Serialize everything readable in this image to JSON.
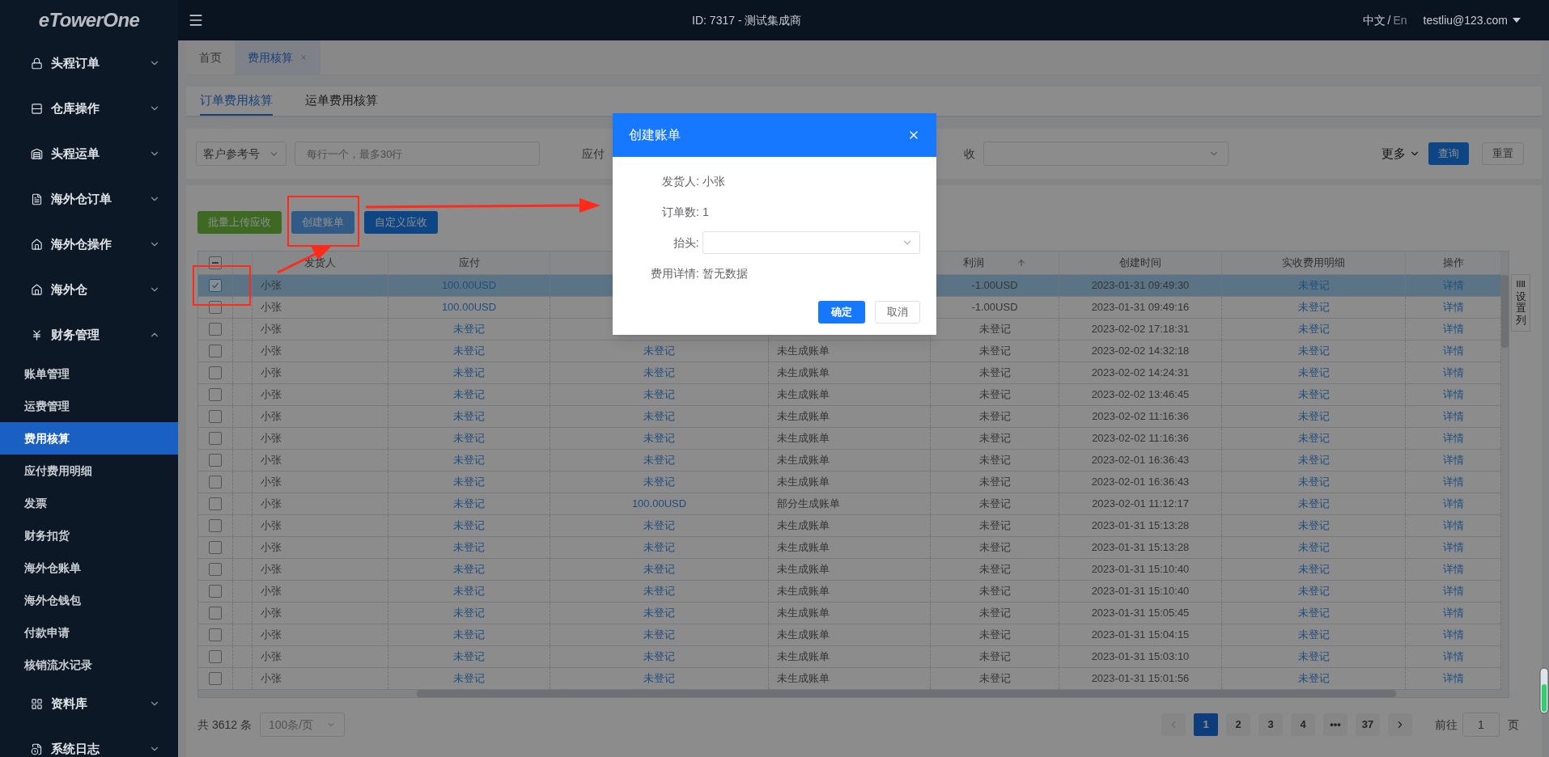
{
  "header": {
    "logo": "eTowerOne",
    "title": "ID: 7317 - 测试集成商",
    "language_current": "中文",
    "language_separator": "/",
    "language_other": "En",
    "user": "testliu@123.com"
  },
  "sidebar": {
    "items": [
      {
        "label": "头程订单",
        "expanded": false
      },
      {
        "label": "仓库操作",
        "expanded": false
      },
      {
        "label": "头程运单",
        "expanded": false
      },
      {
        "label": "海外仓订单",
        "expanded": false
      },
      {
        "label": "海外仓操作",
        "expanded": false
      },
      {
        "label": "海外仓",
        "expanded": false
      },
      {
        "label": "财务管理",
        "expanded": true,
        "children": [
          {
            "label": "账单管理",
            "selected": false
          },
          {
            "label": "运费管理",
            "selected": false
          },
          {
            "label": "费用核算",
            "selected": true
          },
          {
            "label": "应付费用明细",
            "selected": false
          },
          {
            "label": "发票",
            "selected": false
          },
          {
            "label": "财务扣货",
            "selected": false
          },
          {
            "label": "海外仓账单",
            "selected": false
          },
          {
            "label": "海外仓钱包",
            "selected": false
          },
          {
            "label": "付款申请",
            "selected": false
          },
          {
            "label": "核销流水记录",
            "selected": false
          }
        ]
      },
      {
        "label": "资料库",
        "expanded": false
      },
      {
        "label": "系统日志",
        "expanded": false
      }
    ]
  },
  "page_tabs": [
    {
      "label": "首页",
      "selected": false,
      "closable": false
    },
    {
      "label": "费用核算",
      "selected": true,
      "closable": true
    }
  ],
  "sub_tabs": [
    {
      "label": "订单费用核算",
      "selected": true
    },
    {
      "label": "运单费用核算",
      "selected": false
    }
  ],
  "filters": {
    "field_select": "客户参考号",
    "input_placeholder": "每行一个，最多30行",
    "label_1": "应付",
    "label_2": "收",
    "more": "更多",
    "search_button": "查询",
    "reset_button": "重置"
  },
  "actions": [
    {
      "label": "批量上传应收",
      "kind": "success"
    },
    {
      "label": "创建账单",
      "kind": "light"
    },
    {
      "label": "自定义应收",
      "kind": "primary"
    }
  ],
  "table": {
    "header_checkbox_indeterminate": true,
    "columns": {
      "shipper": "发货人",
      "payable": "应付",
      "profit": "利润",
      "created": "创建时间",
      "received_detail": "实收费用明细",
      "action": "操作"
    },
    "rows": [
      {
        "selected": true,
        "shipper": "小张",
        "payable": "100.00USD",
        "profit": "-1.00USD",
        "created": "2023-01-31 09:49:30",
        "received_detail": "未登记",
        "action": "详情"
      },
      {
        "selected": false,
        "shipper": "小张",
        "payable": "100.00USD",
        "profit": "-1.00USD",
        "created": "2023-01-31 09:49:16",
        "received_detail": "未登记",
        "action": "详情"
      },
      {
        "selected": false,
        "shipper": "小张",
        "payable": "未登记",
        "profit": "未登记",
        "created": "2023-02-02 17:18:31",
        "received_detail": "未登记",
        "action": "详情"
      },
      {
        "selected": false,
        "shipper": "小张",
        "payable": "未登记",
        "column_3": "未登记",
        "column_4": "未生成账单",
        "profit": "未登记",
        "created": "2023-02-02 14:32:18",
        "received_detail": "未登记",
        "action": "详情"
      },
      {
        "selected": false,
        "shipper": "小张",
        "payable": "未登记",
        "column_3": "未登记",
        "column_4": "未生成账单",
        "profit": "未登记",
        "created": "2023-02-02 14:24:31",
        "received_detail": "未登记",
        "action": "详情"
      },
      {
        "selected": false,
        "shipper": "小张",
        "payable": "未登记",
        "column_3": "未登记",
        "column_4": "未生成账单",
        "profit": "未登记",
        "created": "2023-02-02 13:46:45",
        "received_detail": "未登记",
        "action": "详情"
      },
      {
        "selected": false,
        "shipper": "小张",
        "payable": "未登记",
        "column_3": "未登记",
        "column_4": "未生成账单",
        "profit": "未登记",
        "created": "2023-02-02 11:16:36",
        "received_detail": "未登记",
        "action": "详情"
      },
      {
        "selected": false,
        "shipper": "小张",
        "payable": "未登记",
        "column_3": "未登记",
        "column_4": "未生成账单",
        "profit": "未登记",
        "created": "2023-02-02 11:16:36",
        "received_detail": "未登记",
        "action": "详情"
      },
      {
        "selected": false,
        "shipper": "小张",
        "payable": "未登记",
        "column_3": "未登记",
        "column_4": "未生成账单",
        "profit": "未登记",
        "created": "2023-02-01 16:36:43",
        "received_detail": "未登记",
        "action": "详情"
      },
      {
        "selected": false,
        "shipper": "小张",
        "payable": "未登记",
        "column_3": "未登记",
        "column_4": "未生成账单",
        "profit": "未登记",
        "created": "2023-02-01 16:36:43",
        "received_detail": "未登记",
        "action": "详情"
      },
      {
        "selected": false,
        "shipper": "小张",
        "payable": "未登记",
        "column_3": "100.00USD",
        "column_4": "部分生成账单",
        "profit": "未登记",
        "created": "2023-02-01 11:12:17",
        "received_detail": "未登记",
        "action": "详情"
      },
      {
        "selected": false,
        "shipper": "小张",
        "payable": "未登记",
        "column_3": "未登记",
        "column_4": "未生成账单",
        "profit": "未登记",
        "created": "2023-01-31 15:13:28",
        "received_detail": "未登记",
        "action": "详情"
      },
      {
        "selected": false,
        "shipper": "小张",
        "payable": "未登记",
        "column_3": "未登记",
        "column_4": "未生成账单",
        "profit": "未登记",
        "created": "2023-01-31 15:13:28",
        "received_detail": "未登记",
        "action": "详情"
      },
      {
        "selected": false,
        "shipper": "小张",
        "payable": "未登记",
        "column_3": "未登记",
        "column_4": "未生成账单",
        "profit": "未登记",
        "created": "2023-01-31 15:10:40",
        "received_detail": "未登记",
        "action": "详情"
      },
      {
        "selected": false,
        "shipper": "小张",
        "payable": "未登记",
        "column_3": "未登记",
        "column_4": "未生成账单",
        "profit": "未登记",
        "created": "2023-01-31 15:10:40",
        "received_detail": "未登记",
        "action": "详情"
      },
      {
        "selected": false,
        "shipper": "小张",
        "payable": "未登记",
        "column_3": "未登记",
        "column_4": "未生成账单",
        "profit": "未登记",
        "created": "2023-01-31 15:05:45",
        "received_detail": "未登记",
        "action": "详情"
      },
      {
        "selected": false,
        "shipper": "小张",
        "payable": "未登记",
        "column_3": "未登记",
        "column_4": "未生成账单",
        "profit": "未登记",
        "created": "2023-01-31 15:04:15",
        "received_detail": "未登记",
        "action": "详情"
      },
      {
        "selected": false,
        "shipper": "小张",
        "payable": "未登记",
        "column_3": "未登记",
        "column_4": "未生成账单",
        "profit": "未登记",
        "created": "2023-01-31 15:03:10",
        "received_detail": "未登记",
        "action": "详情"
      },
      {
        "selected": false,
        "shipper": "小张",
        "payable": "未登记",
        "column_3": "未登记",
        "column_4": "未生成账单",
        "profit": "未登记",
        "created": "2023-01-31 15:01:56",
        "received_detail": "未登记",
        "action": "详情"
      }
    ]
  },
  "settings_tab": "设置列",
  "pagination": {
    "total": "共 3612 条",
    "page_size": "100条/页",
    "prev_disabled": true,
    "next_disabled": false,
    "pages": [
      {
        "label": "1",
        "selected": true
      },
      {
        "label": "2",
        "selected": false
      },
      {
        "label": "3",
        "selected": false
      },
      {
        "label": "4",
        "selected": false
      },
      {
        "label": "•••",
        "selected": false
      },
      {
        "label": "37",
        "selected": false
      }
    ],
    "goto_label": "前往",
    "goto_value": "1",
    "goto_suffix": "页"
  },
  "dialog": {
    "title": "创建账单",
    "fields": [
      {
        "kind": "text",
        "label": "发货人:",
        "value": "小张"
      },
      {
        "kind": "text",
        "label": "订单数:",
        "value": "1"
      },
      {
        "kind": "select",
        "label": "抬头:"
      },
      {
        "kind": "text",
        "label": "费用详情:",
        "value": "暂无数据"
      }
    ],
    "confirm": "确定",
    "cancel": "取消"
  }
}
